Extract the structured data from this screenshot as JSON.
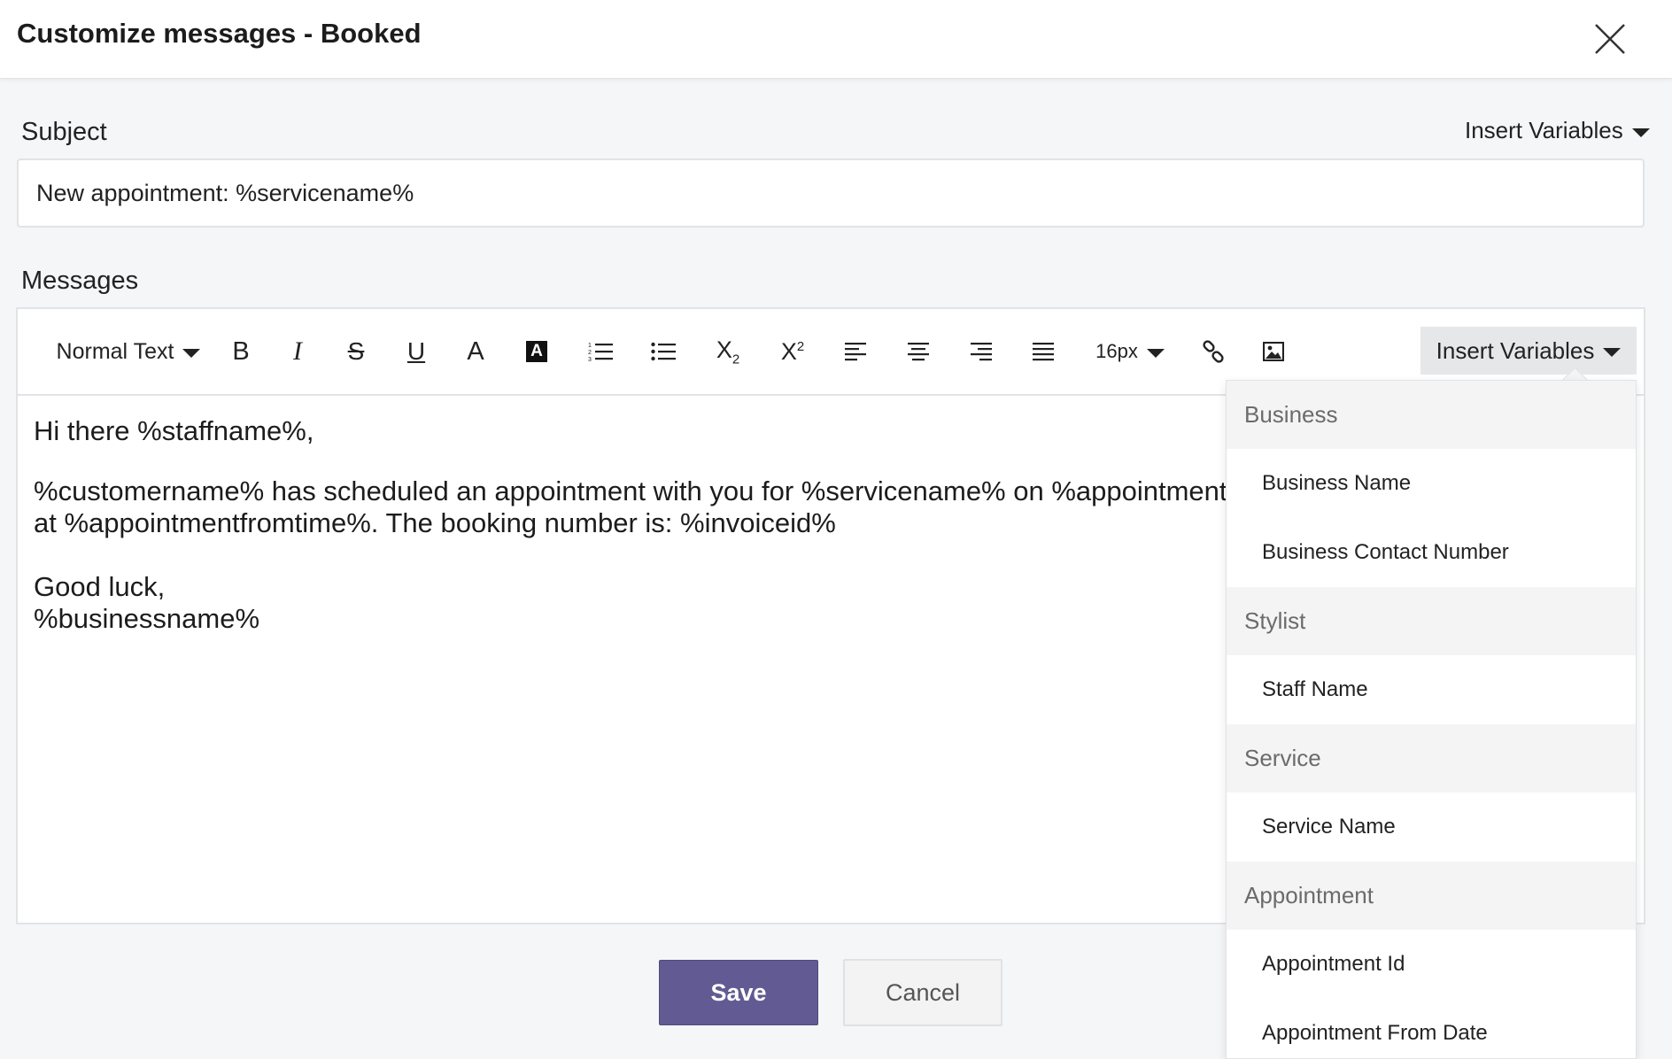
{
  "dialog": {
    "title": "Customize messages - Booked"
  },
  "subject": {
    "label": "Subject",
    "insert_variables": "Insert Variables",
    "value": "New appointment: %servicename%"
  },
  "messages": {
    "label": "Messages",
    "toolbar": {
      "text_style": "Normal Text",
      "bold": "B",
      "italic": "I",
      "strikethrough": "S",
      "underline": "U",
      "font_color": "A",
      "highlight": "A",
      "subscript_base": "X",
      "subscript_mark": "2",
      "superscript_base": "X",
      "superscript_mark": "2",
      "font_size": "16px",
      "insert_variables": "Insert Variables"
    },
    "body": {
      "line1": "Hi there %staffname%,",
      "line2": "%customername% has scheduled an appointment with you for %servicename% on %appointmentfromdate%",
      "line3": "at %appointmentfromtime%. The booking number is: %invoiceid%",
      "line4": "Good luck,",
      "line5": "%businessname%"
    }
  },
  "variables_menu": {
    "groups": [
      {
        "label": "Business",
        "items": [
          "Business Name",
          "Business Contact Number"
        ]
      },
      {
        "label": "Stylist",
        "items": [
          "Staff Name"
        ]
      },
      {
        "label": "Service",
        "items": [
          "Service Name"
        ]
      },
      {
        "label": "Appointment",
        "items": [
          "Appointment Id",
          "Appointment From Date"
        ]
      }
    ]
  },
  "actions": {
    "save": "Save",
    "cancel": "Cancel"
  },
  "colors": {
    "primary": "#625a92",
    "background": "#f5f6f7",
    "group_header_bg": "#f4f4f5"
  }
}
